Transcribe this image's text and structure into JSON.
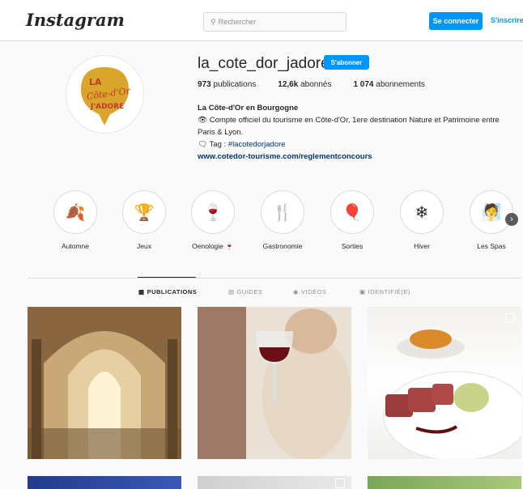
{
  "header": {
    "logo": "Instagram",
    "search_placeholder": "Rechercher",
    "login_label": "Se connecter",
    "signup_label": "S'inscrire"
  },
  "profile": {
    "username": "la_cote_dor_jadore",
    "follow_label": "S'abonner",
    "avatar_text": [
      "LA",
      "Côte-d'Or",
      "J'ADORE"
    ],
    "stats": [
      {
        "value": "973",
        "label": "publications"
      },
      {
        "value": "12,6k",
        "label": "abonnés"
      },
      {
        "value": "1 074",
        "label": "abonnements"
      }
    ],
    "bio": {
      "name": "La Côte-d'Or en Bourgogne",
      "line1": "Compte officiel du tourisme en Côte-d'Or, 1ere destination Nature et Patrimoine entre Paris & Lyon.",
      "tag_prefix": "Tag : ",
      "tag": "#lacotedorjadore",
      "link": "www.cotedor-tourisme.com/reglementconcours"
    }
  },
  "highlights": [
    {
      "label": "Automne",
      "icon": "autumn-leaves-icon",
      "glyph": "🍂"
    },
    {
      "label": "Jeux",
      "icon": "trophy-icon",
      "glyph": "🏆"
    },
    {
      "label": "Oenologie 🍷",
      "icon": "wine-glass-icon",
      "glyph": "🍷"
    },
    {
      "label": "Gastronomie",
      "icon": "cutlery-icon",
      "glyph": "🍴"
    },
    {
      "label": "Sorties",
      "icon": "balloon-icon",
      "glyph": "🎈"
    },
    {
      "label": "Hiver",
      "icon": "snowflake-icon",
      "glyph": "❄"
    },
    {
      "label": "Les Spas",
      "icon": "spa-person-icon",
      "glyph": "🧖"
    }
  ],
  "tabs": [
    {
      "label": "PUBLICATIONS",
      "icon": "grid-icon",
      "glyph": "▦",
      "active": true
    },
    {
      "label": "GUIDES",
      "icon": "guide-icon",
      "glyph": "▤",
      "active": false
    },
    {
      "label": "VIDÉOS",
      "icon": "video-icon",
      "glyph": "◉",
      "active": false
    },
    {
      "label": "IDENTIFIÉ(E)",
      "icon": "tagged-icon",
      "glyph": "▣",
      "active": false
    }
  ],
  "colors": {
    "accent": "#0095f6",
    "avatar_yellow": "#d9a52a",
    "avatar_red": "#c0392b"
  }
}
